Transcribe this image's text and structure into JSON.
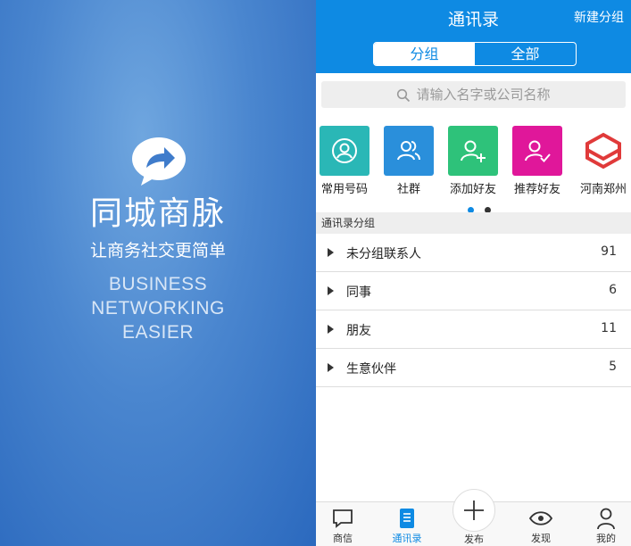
{
  "splash": {
    "app_name": "同城商脉",
    "slogan": "让商务社交更简单",
    "english_lines": [
      "BUSINESS",
      "NETWORKING",
      "EASIER"
    ]
  },
  "header": {
    "title": "通讯录",
    "new_group_label": "新建分组",
    "segments": [
      "分组",
      "全部"
    ],
    "active_segment": "分组",
    "color": "#0e8ae3"
  },
  "search": {
    "placeholder": "请输入名字或公司名称"
  },
  "shortcuts": [
    {
      "label": "常用号码",
      "icon": "contact-card-icon",
      "color": "#2ab7b6"
    },
    {
      "label": "社群",
      "icon": "group-icon",
      "color": "#2a8fdb"
    },
    {
      "label": "添加好友",
      "icon": "add-friend-icon",
      "color": "#2ec27a"
    },
    {
      "label": "推荐好友",
      "icon": "recommend-friend-icon",
      "color": "#e0179a"
    },
    {
      "label": "河南郑州",
      "icon": "henan-zhengzhou-logo",
      "color": "#e03a3a"
    }
  ],
  "pager": {
    "pages": 2,
    "current": 1
  },
  "section_title": "通讯录分组",
  "groups": [
    {
      "name": "未分组联系人",
      "count": "91"
    },
    {
      "name": "同事",
      "count": "6"
    },
    {
      "name": "朋友",
      "count": "11"
    },
    {
      "name": "生意伙伴",
      "count": "5"
    }
  ],
  "tabbar": {
    "tabs": [
      {
        "label": "商信",
        "icon": "chat-icon"
      },
      {
        "label": "通讯录",
        "icon": "contacts-book-icon",
        "active": true
      },
      {
        "label": "发布",
        "icon": "plus-icon"
      },
      {
        "label": "发现",
        "icon": "eye-icon"
      },
      {
        "label": "我的",
        "icon": "user-icon"
      }
    ]
  }
}
